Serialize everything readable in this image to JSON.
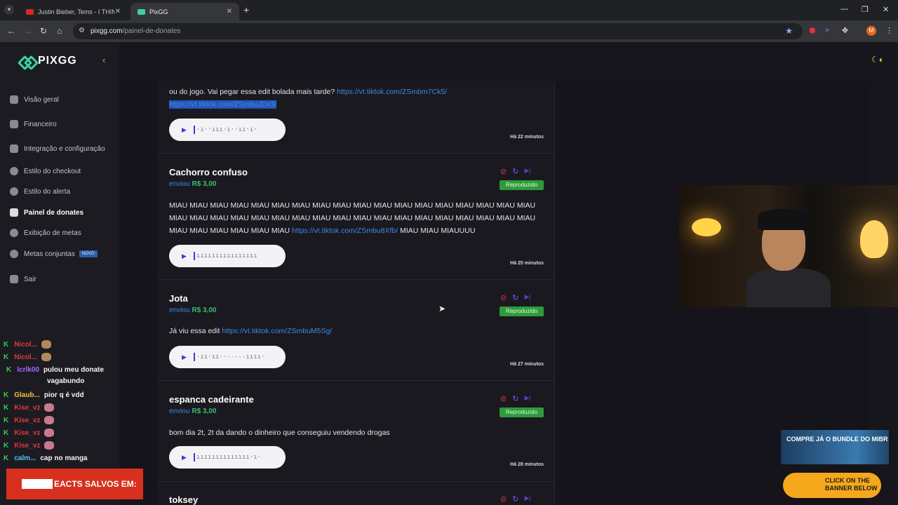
{
  "browser": {
    "tabs": [
      {
        "title": "Justin Bieber, Tems - I THINK YOU",
        "active": false,
        "favicon_color": "#e02424"
      },
      {
        "title": "PixGG",
        "active": true,
        "favicon_color": "#3ad29f"
      }
    ],
    "url_host": "pixgg.com",
    "url_path": "/painel-de-donates",
    "profile_initial": "M"
  },
  "sidebar": {
    "logo": "PIXGG",
    "items": [
      {
        "label": "Visão geral"
      },
      {
        "label": "Financeiro"
      },
      {
        "label": "Integração e configuração"
      },
      {
        "label": "Estilo do checkout"
      },
      {
        "label": "Estilo do alerta"
      },
      {
        "label": "Painel de donates"
      },
      {
        "label": "Exibição de metas"
      },
      {
        "label": "Metas conjuntas",
        "badge": "NOVO"
      },
      {
        "label": "Sair"
      }
    ]
  },
  "donations": [
    {
      "msg_top": "ou do jogo. Vai pegar essa edit bolada mais tarde?",
      "link1": "https://vt.tiktok.com/ZSmbm7Ck5/",
      "link2": "https://vt.tiktok.com/ZSmbuJDv3/",
      "ago": "Há 22 minutos"
    },
    {
      "name": "Cachorro confuso",
      "sent_label": "enviou",
      "amount": "R$ 3,00",
      "status": "Reproduzido",
      "msg_a": "MIAU MIAU MIAU MIAU MIAU MIAU MIAU MIAU MIAU MIAU MIAU MIAU MIAU MIAU MIAU MIAU MIAU MIAU MIAU MIAU MIAU MIAU MIAU MIAU MIAU MIAU MIAU MIAU MIAU MIAU MIAU MIAU MIAU MIAU MIAU MIAU MIAU MIAU MIAU MIAU MIAU MIAU",
      "link": "https://vt.tiktok.com/ZSmbu8Xfb/",
      "msg_b": "MIAU MIAU MIAUUUU",
      "ago": "Há 25 minutos"
    },
    {
      "name": "Jota",
      "sent_label": "enviou",
      "amount": "R$ 3,00",
      "status": "Reproduzido",
      "msg_a": "Já viu essa edit",
      "link": "https://vt.tiktok.com/ZSmbuM5Sg/",
      "ago": "Há 27 minutos"
    },
    {
      "name": "espanca cadeirante",
      "sent_label": "enviou",
      "amount": "R$ 3,00",
      "status": "Reproduzido",
      "msg_a": "bom dia 2t, 2t da dando o dinheiro que conseguiu vendendo drogas",
      "ago": "Há 28 minutos"
    },
    {
      "name": "toksey"
    }
  ],
  "chat": [
    {
      "user": "Nicol...",
      "user_color": "#e03a3a",
      "msg": ""
    },
    {
      "user": "Nicol...",
      "user_color": "#e03a3a",
      "msg": ""
    },
    {
      "user": "lcrlk00",
      "user_color": "#a86bff",
      "msg": "pulou meu donate",
      "msg2": "vagabundo"
    },
    {
      "user": "Glaub...",
      "user_color": "#f2c232",
      "msg": "pior q é vdd"
    },
    {
      "user": "Kise_vz",
      "user_color": "#e03a3a",
      "msg": ""
    },
    {
      "user": "Kise_vz",
      "user_color": "#e03a3a",
      "msg": ""
    },
    {
      "user": "Kise_vz",
      "user_color": "#e03a3a",
      "msg": ""
    },
    {
      "user": "Kise_vz",
      "user_color": "#e03a3a",
      "msg": ""
    },
    {
      "user": "calm...",
      "user_color": "#4fc3f7",
      "msg": "cap no manga"
    }
  ],
  "overlays": {
    "reacts_banner": "EACTS SALVOS EM:",
    "mibr_ad": "COMPRE JÁ O BUNDLE DO MIBR",
    "click_ad": "CLICK ON THE BANNER BELOW"
  }
}
